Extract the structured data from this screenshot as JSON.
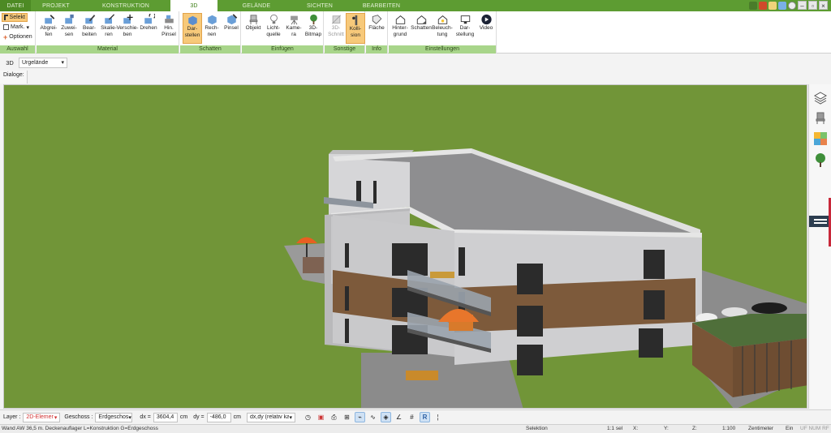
{
  "menu": {
    "tabs": [
      "DATEI",
      "PROJEKT",
      "KONSTRUKTION",
      "3D",
      "GELÄNDE",
      "SICHTEN",
      "BEARBEITEN"
    ]
  },
  "ribbon": {
    "auswahl": {
      "selekt": "Selekt",
      "mark": "Mark.",
      "optionen": "Optionen",
      "label": "Auswahl"
    },
    "material": {
      "buttons": [
        "Abgrei-\nfen",
        "Zuwei-\nsen",
        "Bear-\nbeiten",
        "Skalie-\nren",
        "Verschie-\nben",
        "Drehen",
        "Hin.\nPinsel"
      ],
      "label": "Material"
    },
    "schatten": {
      "buttons": [
        "Dar-\nstellen",
        "Rech-\nnen",
        "Pinsel"
      ],
      "label": "Schatten"
    },
    "einfuegen": {
      "buttons": [
        "Objekt",
        "Licht-\nquelle",
        "Kame-\nra",
        "3D-\nBitmap"
      ],
      "label": "Einfügen"
    },
    "sonstige": {
      "buttons": [
        "3D-\nSchnitt",
        "Kolli-\nsion"
      ],
      "label": "Sonstige"
    },
    "info": {
      "buttons": [
        "Fläche"
      ],
      "label": "Info"
    },
    "einstellungen": {
      "buttons": [
        "Hinter-\ngrund",
        "Schatten",
        "Beleuch-\ntung",
        "Dar-\nstellung",
        "Video"
      ],
      "label": "Einstellungen"
    }
  },
  "viewbar": {
    "view": "3D",
    "terrain": "Urgelände"
  },
  "dialog": {
    "label": "Dialoge:"
  },
  "toolbar": {
    "layer_label": "Layer :",
    "layer_value": "2D-Elemer",
    "floor_label": "Geschoss :",
    "floor_value": "Erdgeschos",
    "dx_label": "dx =",
    "dx_value": "3604,4",
    "dx_unit": "cm",
    "dy_label": "dy =",
    "dy_value": "-486,0",
    "dy_unit": "cm",
    "mode_value": "dx,dy (relativ ka"
  },
  "status": {
    "message": "Wand AW 36,5 m. Deckenauflager L=Konstruktion G=Erdgeschoss",
    "mode": "Selektion",
    "sel": "1:1 sel",
    "x": "X:",
    "y": "Y:",
    "z": "Z:",
    "scale": "1:100",
    "unit": "Zentimeter",
    "ein": "Ein",
    "flags": "UF NUM RF"
  },
  "colors": {
    "ribbon_green": "#5d9c32",
    "group_label_bg": "#a8d58a",
    "active_button": "#f7c97a",
    "grass": "#719538",
    "render_wall": "#c9c9cb",
    "wood_band": "#7d5a3b"
  }
}
